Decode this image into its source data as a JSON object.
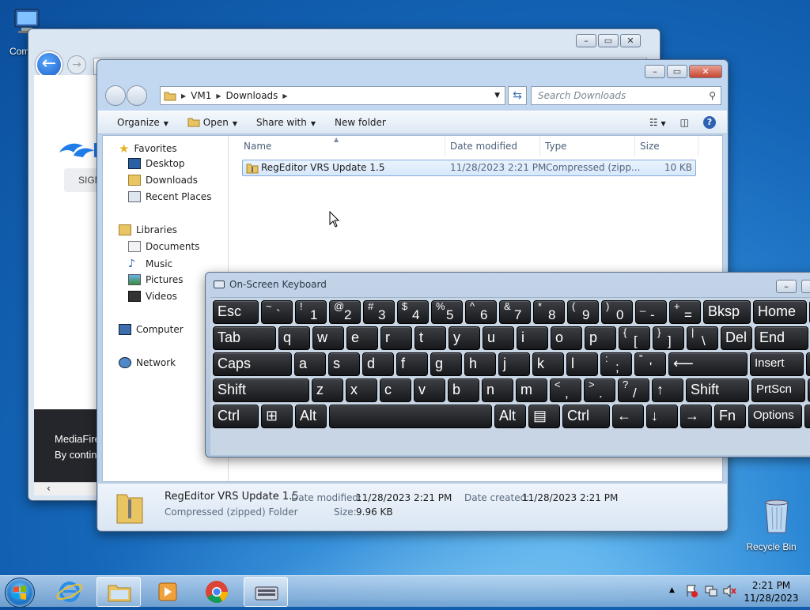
{
  "desktop": {
    "computer_label": "Com",
    "recycle_bin_label": "Recycle Bin"
  },
  "browser": {
    "sign_label": "SIGN",
    "footer_line1": "MediaFire",
    "footer_line2": "By contin"
  },
  "explorer": {
    "breadcrumb": [
      "VM1",
      "Downloads"
    ],
    "search_placeholder": "Search Downloads",
    "toolbar": {
      "organize": "Organize",
      "open": "Open",
      "share_with": "Share with",
      "new_folder": "New folder"
    },
    "nav": {
      "favorites": "Favorites",
      "desktop": "Desktop",
      "downloads": "Downloads",
      "recent_places": "Recent Places",
      "libraries": "Libraries",
      "documents": "Documents",
      "music": "Music",
      "pictures": "Pictures",
      "videos": "Videos",
      "computer": "Computer",
      "network": "Network"
    },
    "columns": {
      "name": "Name",
      "date_modified": "Date modified",
      "type": "Type",
      "size": "Size"
    },
    "files": [
      {
        "name": "RegEditor VRS Update 1.5",
        "date_modified": "11/28/2023 2:21 PM",
        "type": "Compressed (zipp...",
        "size": "10 KB"
      }
    ],
    "details": {
      "name": "RegEditor VRS Update 1.5",
      "date_modified_label": "Date modified:",
      "date_modified": "11/28/2023 2:21 PM",
      "date_created_label": "Date created:",
      "date_created": "11/28/2023 2:21 PM",
      "type": "Compressed (zipped) Folder",
      "size_label": "Size:",
      "size": "9.96 KB"
    }
  },
  "osk": {
    "title": "On-Screen Keyboard",
    "rows": [
      [
        {
          "label": "Esc"
        },
        {
          "top": "~",
          "bot": "`"
        },
        {
          "top": "!",
          "bot": "1"
        },
        {
          "top": "@",
          "bot": "2"
        },
        {
          "top": "#",
          "bot": "3"
        },
        {
          "top": "$",
          "bot": "4"
        },
        {
          "top": "%",
          "bot": "5"
        },
        {
          "top": "^",
          "bot": "6"
        },
        {
          "top": "&",
          "bot": "7"
        },
        {
          "top": "*",
          "bot": "8"
        },
        {
          "top": "(",
          "bot": "9"
        },
        {
          "top": ")",
          "bot": "0"
        },
        {
          "top": "_",
          "bot": "-"
        },
        {
          "top": "+",
          "bot": "="
        },
        {
          "label": "Bksp"
        },
        {
          "label": "Home"
        },
        {
          "label": "P"
        }
      ],
      [
        {
          "label": "Tab"
        },
        {
          "label": "q"
        },
        {
          "label": "w"
        },
        {
          "label": "e"
        },
        {
          "label": "r"
        },
        {
          "label": "t"
        },
        {
          "label": "y"
        },
        {
          "label": "u"
        },
        {
          "label": "i"
        },
        {
          "label": "o"
        },
        {
          "label": "p"
        },
        {
          "top": "{",
          "bot": "["
        },
        {
          "top": "}",
          "bot": "]"
        },
        {
          "top": "|",
          "bot": "\\"
        },
        {
          "label": "Del"
        },
        {
          "label": "End"
        },
        {
          "label": "P"
        }
      ],
      [
        {
          "label": "Caps"
        },
        {
          "label": "a"
        },
        {
          "label": "s"
        },
        {
          "label": "d"
        },
        {
          "label": "f"
        },
        {
          "label": "g"
        },
        {
          "label": "h"
        },
        {
          "label": "j"
        },
        {
          "label": "k"
        },
        {
          "label": "l"
        },
        {
          "top": ":",
          "bot": ";"
        },
        {
          "top": "\"",
          "bot": "'"
        },
        {
          "label": "⟵"
        },
        {
          "label": "Insert"
        },
        {
          "label": "P"
        }
      ],
      [
        {
          "label": "Shift"
        },
        {
          "label": "z"
        },
        {
          "label": "x"
        },
        {
          "label": "c"
        },
        {
          "label": "v"
        },
        {
          "label": "b"
        },
        {
          "label": "n"
        },
        {
          "label": "m"
        },
        {
          "top": "<",
          "bot": ","
        },
        {
          "top": ">",
          "bot": "."
        },
        {
          "top": "?",
          "bot": "/"
        },
        {
          "label": "↑"
        },
        {
          "label": "Shift"
        },
        {
          "label": "PrtScn"
        },
        {
          "label": "S"
        }
      ],
      [
        {
          "label": "Ctrl"
        },
        {
          "label": "⊞"
        },
        {
          "label": "Alt"
        },
        {
          "label": ""
        },
        {
          "label": "Alt"
        },
        {
          "label": "▤"
        },
        {
          "label": "Ctrl"
        },
        {
          "label": "←"
        },
        {
          "label": "↓"
        },
        {
          "label": "→"
        },
        {
          "label": "Fn"
        },
        {
          "label": "Options"
        },
        {
          "label": "H"
        }
      ]
    ]
  },
  "taskbar": {
    "time": "2:21 PM",
    "date": "11/28/2023"
  }
}
